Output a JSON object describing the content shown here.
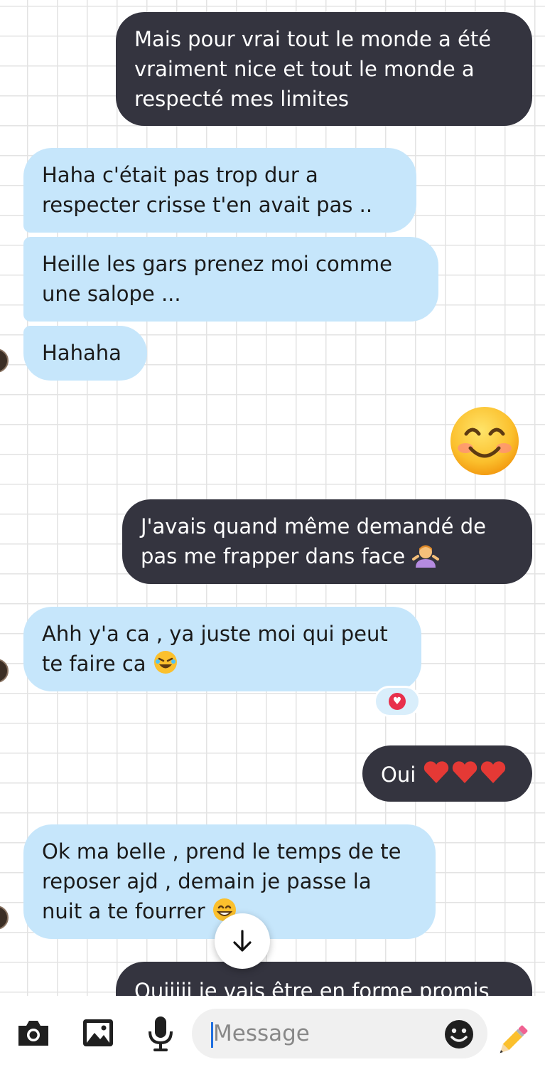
{
  "messages": [
    {
      "id": "m1",
      "direction": "sent",
      "lines": [
        "Mais pour vrai tout le monde a été",
        "vraiment nice et tout le monde a",
        "respecté mes limites"
      ]
    },
    {
      "id": "m2",
      "direction": "received",
      "lines": [
        "Haha c'était pas trop dur a",
        "respecter crisse t'en avait pas  .."
      ]
    },
    {
      "id": "m3",
      "direction": "received",
      "lines": [
        "Heille les gars prenez moi comme",
        "une salope ..."
      ]
    },
    {
      "id": "m4",
      "direction": "received",
      "lines": [
        "Hahaha"
      ]
    },
    {
      "id": "m5",
      "direction": "sent",
      "emoji": "smiling-face-with-smiling-eyes"
    },
    {
      "id": "m6",
      "direction": "sent",
      "lines": [
        "J'avais quand même demandé de",
        "pas me frapper dans face"
      ],
      "trailing_emoji": "person-shrugging"
    },
    {
      "id": "m7",
      "direction": "received",
      "lines": [
        "Ahh y'a ca , ya juste moi qui peut",
        "te faire ca"
      ],
      "trailing_emoji": "rolling-on-floor-laughing",
      "reaction": "heart"
    },
    {
      "id": "m8",
      "direction": "sent",
      "text": "Oui",
      "trailing_emoji": "three-red-hearts"
    },
    {
      "id": "m9",
      "direction": "received",
      "lines": [
        "Ok ma belle , prend le temps de te",
        "reposer ajd , demain je passe la",
        "nuit a te fourrer"
      ],
      "trailing_emoji": "grinning-face"
    },
    {
      "id": "m10",
      "direction": "sent",
      "lines": [
        "Ouiiiii je vais être en forme promis"
      ],
      "partially_visible": true
    }
  ],
  "composer": {
    "placeholder": "Message",
    "icons": [
      "camera-icon",
      "gallery-icon",
      "microphone-icon",
      "emoji-icon",
      "pencil-icon"
    ]
  },
  "scroll_button": {
    "icon": "arrow-down-icon"
  },
  "colors": {
    "sent_bubble": "#34343f",
    "received_bubble": "#c6e6fb",
    "grid": "#e3e3e3",
    "reaction": "#e8304c"
  }
}
